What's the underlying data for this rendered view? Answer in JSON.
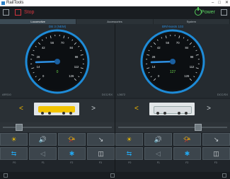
{
  "window": {
    "title": "RailTools"
  },
  "topbar": {
    "stop_label": "Stop",
    "power_label": "Power"
  },
  "tabs": [
    {
      "label": "Locomotive"
    },
    {
      "label": "Accessories"
    },
    {
      "label": "System"
    }
  ],
  "left": {
    "loco_name": "DB 3 (NEM)",
    "speed_value": "0",
    "address_left": "ARS10",
    "address_right": "DCC/SX",
    "gauge_ticks": [
      "0",
      "14",
      "28",
      "42",
      "56",
      "70",
      "84",
      "98",
      "112",
      "126"
    ],
    "function_labels": [
      "F0",
      "F1",
      "F2",
      "F3"
    ],
    "colors": {
      "accent": "#1e8bd7",
      "needle": "#2d8ee0",
      "speed": "#6bd44b"
    }
  },
  "right": {
    "loco_name": "BR/Hvasts 103",
    "speed_value": "127",
    "address_left": "L3672",
    "address_right": "DCC/SX",
    "gauge_ticks": [
      "0",
      "14",
      "28",
      "42",
      "56",
      "70",
      "84",
      "98",
      "112",
      "126"
    ],
    "function_labels": [
      "F0",
      "F1",
      "F2",
      "F3"
    ],
    "colors": {
      "accent": "#1e8bd7",
      "needle": "#2d8ee0",
      "speed": "#6bd44b"
    }
  },
  "gauge_levels": {
    "left": 0.16,
    "right": 0.16
  }
}
